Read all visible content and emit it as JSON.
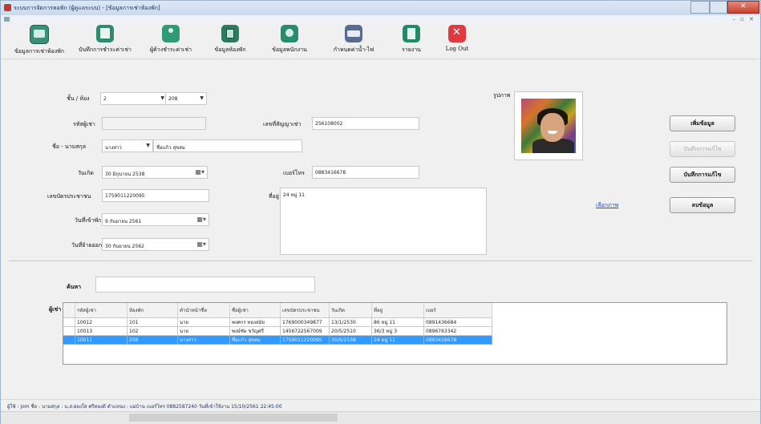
{
  "window": {
    "title": "ระบบการจัดการหอพัก (ผู้ดูแลระบบ) - [ข้อมูลการเช่าห้องพัก]"
  },
  "toolbar": {
    "items": [
      {
        "label": "ข้อมูลการเช่าห้องพัก",
        "icon": "ledger-icon"
      },
      {
        "label": "บันทึกการชำระค่าเช่า",
        "icon": "edit-icon"
      },
      {
        "label": "ผู้ค้างชำระค่าเช่า",
        "icon": "people-icon"
      },
      {
        "label": "ข้อมูลห้องพัก",
        "icon": "room-icon"
      },
      {
        "label": "ข้อมูลพนักงาน",
        "icon": "staff-icon"
      },
      {
        "label": "กำหนดค่าน้ำ-ไฟ",
        "icon": "rate-icon"
      },
      {
        "label": "รายงาน",
        "icon": "report-icon"
      },
      {
        "label": "Log Out",
        "icon": "logout-icon"
      }
    ]
  },
  "form": {
    "floor_room_label": "ชั้น / ห้อง",
    "floor_value": "2",
    "room_value": "208",
    "tenant_id_label": "รหัสผู้เช่า",
    "tenant_id_value": "",
    "contract_label": "เลขที่สัญญาเช่า",
    "contract_value": "256108002",
    "name_label": "ชื่อ - นามสกุล",
    "prefix_value": "นางสาว",
    "name_value": "ชื่อแก้ว สุขสม",
    "birth_label": "วันเกิด",
    "birth_value": "30 มิถุนายน 2538",
    "phone_label": "เบอร์โทร",
    "phone_value": "0883416678",
    "idcard_label": "เลขบัตรประชาชน",
    "idcard_value": "1759011220095",
    "address_label": "ที่อยู่",
    "address_value": "24 หมู่ 11",
    "checkin_label": "วันที่เข้าพัก",
    "checkin_value": "9 กันยายน 2561",
    "checkout_label": "วันที่ย้ายออก",
    "checkout_value": "30 กันยายน 2562",
    "photo_label": "รูปภาพ",
    "photo_link": "เลือกภาพ"
  },
  "buttons": {
    "add": "เพิ่มข้อมูล",
    "edit": "บันทึกการแก้ไข",
    "save": "บันทึกการแก้ไข",
    "delete": "ลบข้อมูล"
  },
  "search": {
    "label": "ค้นหา",
    "value": ""
  },
  "grid": {
    "label": "ผู้เช่า",
    "headers": [
      "รหัสผู้เช่า",
      "ห้องพัก",
      "คำนำหน้าชื่อ",
      "ชื่อผู้เช่า",
      "เลขบัตรประชาชน",
      "วันเกิด",
      "ที่อยู่",
      "เบอร์"
    ],
    "rows": [
      [
        "10012",
        "101",
        "นาย",
        "พงศกร ทองสมัย",
        "1769000349877",
        "13/1/2530",
        "86 หมู่ 11",
        "0891436684"
      ],
      [
        "10013",
        "102",
        "นาย",
        "พงษ์ชัย ขวัญศรี",
        "1456722567009",
        "20/5/2510",
        "36/3 หมู่ 3",
        "0896763342"
      ],
      [
        "10011",
        "208",
        "นางสาว",
        "ชื่อแก้ว สุขสม",
        "1759011220095",
        "30/6/2538",
        "24 หมู่ 11",
        "0883416678"
      ]
    ],
    "selected_row": 2
  },
  "status": {
    "text": "ผู้ใช้ : jom ชื่อ - นามสกุล : น.ส.ผ่องใส ศรีทองดี ตำแหน่ง : แม่บ้าน เบอร์โทร 0882587240 วันที่เข้าใช้งาน 15/10/2561 22:45:00"
  }
}
